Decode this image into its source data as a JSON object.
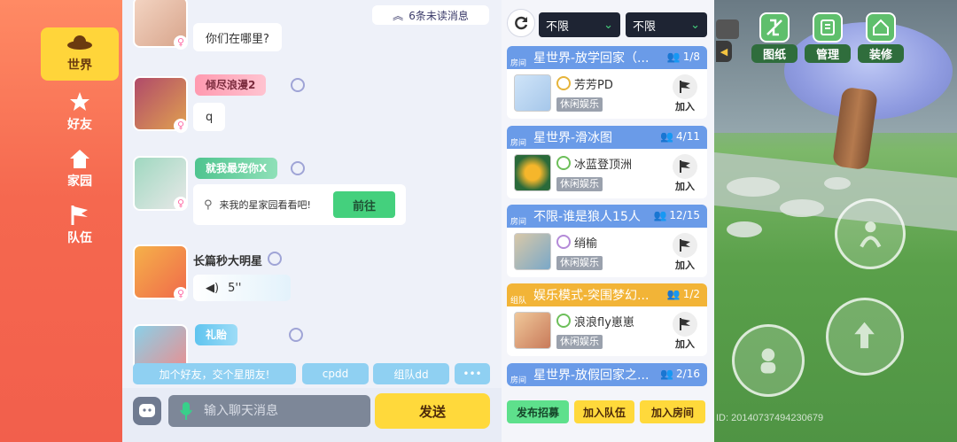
{
  "nav": {
    "items": [
      {
        "label": "世界",
        "icon": "planet-icon",
        "active": true
      },
      {
        "label": "好友",
        "icon": "friend-star-icon",
        "active": false
      },
      {
        "label": "家园",
        "icon": "home-icon",
        "active": false
      },
      {
        "label": "队伍",
        "icon": "flag-icon",
        "active": false
      }
    ]
  },
  "chat": {
    "unread_label": "6条未读消息",
    "messages": [
      {
        "name": "",
        "text": "你们在哪里?"
      },
      {
        "name": "倾尽浪漫2",
        "text": "q"
      },
      {
        "name": "就我最宠你X",
        "invite_text": "来我的星家园看看吧!",
        "invite_button": "前往"
      },
      {
        "name": "长篇秒大明星",
        "voice_duration": "5''"
      },
      {
        "name": "礼貽",
        "text": ""
      }
    ],
    "quick_replies": [
      "加个好友，交个星朋友!",
      "cpdd",
      "组队dd",
      "•••"
    ],
    "input_placeholder": "输入聊天消息",
    "send_label": "发送"
  },
  "rooms": {
    "filter_1": "不限",
    "filter_2": "不限",
    "list": [
      {
        "badge": "房间",
        "title": "星世界-放学回家（...",
        "count": "1/8",
        "host": "芳芳PD",
        "category": "休闲娱乐",
        "join": "加入",
        "color": "#6a9be8"
      },
      {
        "badge": "房间",
        "title": "星世界-滑冰图",
        "count": "4/11",
        "host": "冰蓝登顶洲",
        "category": "休闲娱乐",
        "join": "加入",
        "color": "#6a9be8"
      },
      {
        "badge": "房间",
        "title": "不限-谁是狼人15人",
        "count": "12/15",
        "host": "绡榆",
        "category": "休闲娱乐",
        "join": "加入",
        "color": "#6a9be8"
      },
      {
        "badge": "组队",
        "title": "娱乐模式-突围梦幻...",
        "count": "1/2",
        "host": "浪浪fly崽崽",
        "category": "休闲娱乐",
        "join": "加入",
        "color": "#f2b437"
      },
      {
        "badge": "房间",
        "title": "星世界-放假回家之...",
        "count": "2/16",
        "host": "",
        "category": "",
        "join": "",
        "color": "#6a9be8"
      }
    ],
    "publish_label": "发布招募",
    "join_team_label": "加入队伍",
    "join_room_label": "加入房间"
  },
  "game": {
    "top_buttons": [
      "图纸",
      "管理",
      "装修"
    ],
    "uid_text": "ID: 2014073749423067​9"
  }
}
